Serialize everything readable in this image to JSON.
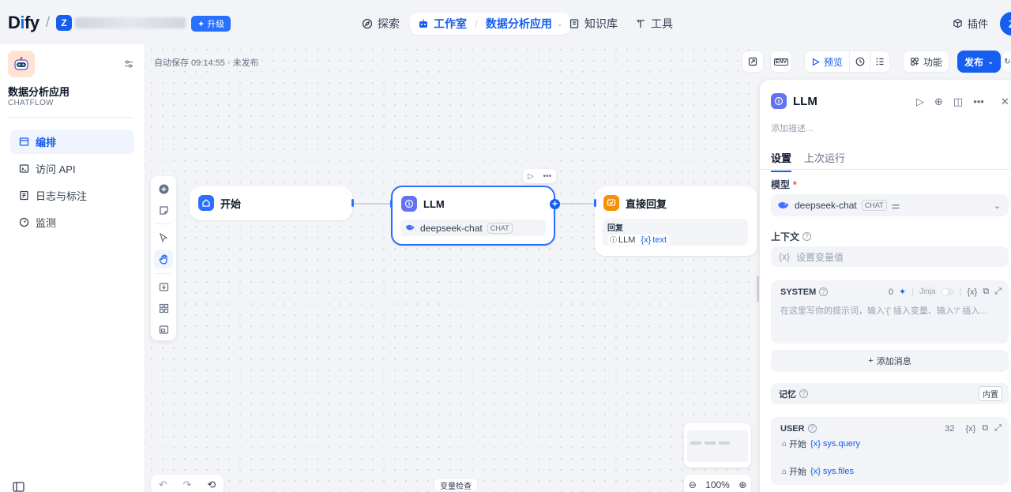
{
  "header": {
    "logo_text": "Dify",
    "workspace_initial": "Z",
    "upgrade_label": "升级",
    "nav": {
      "explore": "探索",
      "studio": "工作室",
      "current_app": "数据分析应用",
      "knowledge": "知识库",
      "tools": "工具"
    },
    "plugins_label": "插件",
    "user_initial": "Z"
  },
  "sidebar": {
    "app_name": "数据分析应用",
    "app_type": "CHATFLOW",
    "items": [
      {
        "label": "编排",
        "icon": "layout-icon",
        "active": true
      },
      {
        "label": "访问 API",
        "icon": "terminal-icon",
        "active": false
      },
      {
        "label": "日志与标注",
        "icon": "file-list-icon",
        "active": false
      },
      {
        "label": "监测",
        "icon": "dashboard-icon",
        "active": false
      }
    ]
  },
  "canvas": {
    "autosave_text": "自动保存 09:14:55 · 未发布",
    "nodes": {
      "start": {
        "title": "开始"
      },
      "llm": {
        "title": "LLM",
        "model": "deepseek-chat",
        "model_tag": "CHAT"
      },
      "answer": {
        "title": "直接回复",
        "reply_label": "回复",
        "reply_source": "LLM",
        "reply_var": "text"
      }
    },
    "zoom": "100%",
    "var_inspect_label": "变量检查",
    "top_buttons": {
      "preview": "预览",
      "features": "功能",
      "publish": "发布",
      "env_label": "ENV"
    }
  },
  "panel": {
    "title": "LLM",
    "description_placeholder": "添加描述...",
    "tabs": [
      "设置",
      "上次运行"
    ],
    "model_label": "模型",
    "model_name": "deepseek-chat",
    "model_tag": "CHAT",
    "context_label": "上下文",
    "context_placeholder": "设置变量值",
    "system": {
      "label": "SYSTEM",
      "count": "0",
      "jinja_label": "Jinja",
      "placeholder": "在这里写你的提示词，输入'{' 插入变量、输入'/' 插入..."
    },
    "add_message_label": "添加消息",
    "memory_label": "记忆",
    "memory_tag": "内置",
    "user": {
      "label": "USER",
      "count": "32",
      "vars": [
        {
          "source": "开始",
          "name": "sys.query"
        },
        {
          "source": "开始",
          "name": "sys.files"
        }
      ]
    }
  },
  "colors": {
    "primary": "#155eef",
    "start_icon_bg": "#2970ff",
    "llm_icon_bg": "#6172f3",
    "answer_icon_bg": "#f79009"
  }
}
